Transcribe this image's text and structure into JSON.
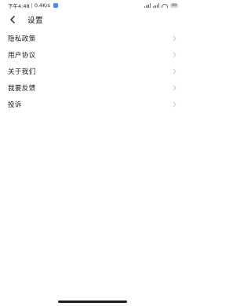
{
  "status_bar": {
    "time": "下午4:48",
    "separator": "|",
    "network_speed": "0.4K/s",
    "battery": "69"
  },
  "header": {
    "title": "设置",
    "back_icon": "chevron-left-icon"
  },
  "menu": {
    "items": [
      {
        "label": "隐私政策"
      },
      {
        "label": "用户协议"
      },
      {
        "label": "关于我们"
      },
      {
        "label": "我要反馈"
      },
      {
        "label": "投诉"
      }
    ],
    "chevron_icon": "chevron-right-icon"
  },
  "colors": {
    "background": "#ffffff",
    "text": "#111111",
    "chevron": "#c8c8c8",
    "status_orange": "#f2a93b",
    "status_blue": "#4a8cf7"
  }
}
